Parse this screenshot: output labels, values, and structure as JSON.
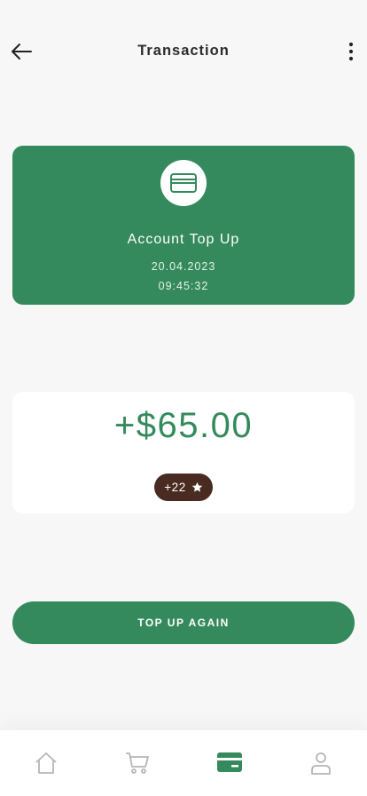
{
  "header": {
    "title": "Transaction",
    "back_icon": "arrow-left-icon",
    "more_icon": "more-vertical-icon"
  },
  "transaction": {
    "icon": "credit-card-icon",
    "title": "Account Top Up",
    "date": "20.04.2023",
    "time": "09:45:32"
  },
  "amount": {
    "value": "+$65.00",
    "points": "+22",
    "points_icon": "star-icon"
  },
  "actions": {
    "top_up_again": "TOP UP AGAIN"
  },
  "bottom_nav": {
    "items": [
      {
        "icon": "home-icon",
        "active": false
      },
      {
        "icon": "cart-icon",
        "active": false
      },
      {
        "icon": "card-icon",
        "active": true
      },
      {
        "icon": "profile-icon",
        "active": false
      }
    ]
  },
  "colors": {
    "brand_green": "#348a5c",
    "badge_brown": "#4a2b22",
    "background": "#f7f7f7",
    "inactive_icon": "#b5b5b5"
  }
}
